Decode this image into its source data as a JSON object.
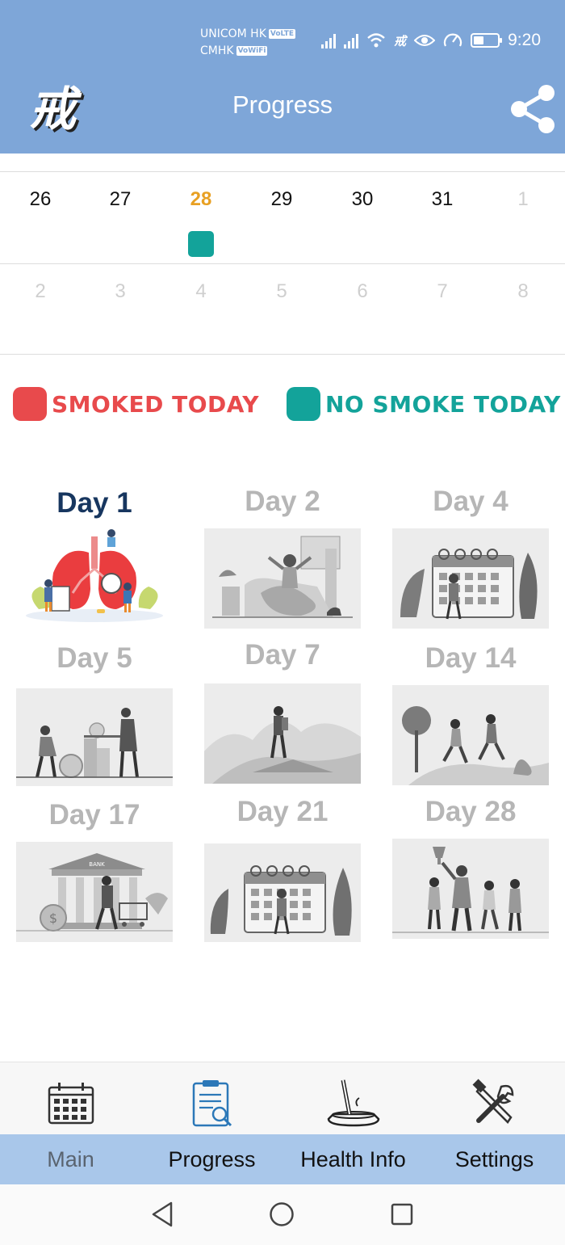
{
  "status_bar": {
    "carrier1": "UNICOM HK",
    "carrier1_tag": "VoLTE",
    "carrier2": "CMHK",
    "carrier2_tag": "VoWiFi",
    "time": "9:20"
  },
  "header": {
    "logo": "戒",
    "title": "Progress",
    "share_icon": "share-icon"
  },
  "calendar": {
    "week1": [
      "26",
      "27",
      "28",
      "29",
      "30",
      "31",
      "1"
    ],
    "week2": [
      "2",
      "3",
      "4",
      "5",
      "6",
      "7",
      "8"
    ],
    "today": "28",
    "no_smoke_color": "#13a39a",
    "today_color": "#e8a023"
  },
  "legend": {
    "smoked_label": "SMOKED TODAY",
    "smoked_color": "#e84a4c",
    "no_smoke_label": "NO SMOKE TODAY",
    "no_smoke_color": "#13a39a"
  },
  "milestones": [
    {
      "label": "Day 1",
      "unlocked": true
    },
    {
      "label": "Day 2",
      "unlocked": false
    },
    {
      "label": "Day 4",
      "unlocked": false
    },
    {
      "label": "Day 5",
      "unlocked": false
    },
    {
      "label": "Day 7",
      "unlocked": false
    },
    {
      "label": "Day 14",
      "unlocked": false
    },
    {
      "label": "Day 17",
      "unlocked": false
    },
    {
      "label": "Day 21",
      "unlocked": false
    },
    {
      "label": "Day 28",
      "unlocked": false
    }
  ],
  "bottom_nav": {
    "items": [
      {
        "label": "Main",
        "icon": "calendar-icon",
        "active": false
      },
      {
        "label": "Progress",
        "icon": "clipboard-search-icon",
        "active": true
      },
      {
        "label": "Health Info",
        "icon": "ashtray-icon",
        "active": false
      },
      {
        "label": "Settings",
        "icon": "tools-icon",
        "active": false
      }
    ]
  }
}
